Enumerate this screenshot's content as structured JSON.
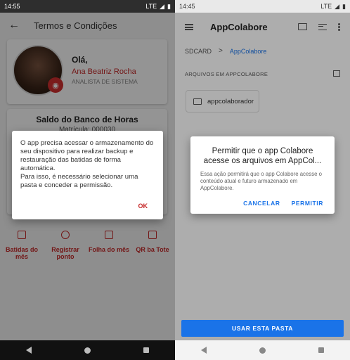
{
  "left": {
    "status_time": "14:55",
    "status_network": "LTE",
    "appbar_title": "Termos e Condições",
    "profile": {
      "greeting": "Olá,",
      "name": "Ana Beatriz Rocha",
      "role": "ANALISTA DE SISTEMA"
    },
    "bank": {
      "title": "Saldo do Banco de Horas",
      "subtitle": "Matrícula: 000030"
    },
    "shortcuts": [
      {
        "label": "Batidas do mês",
        "icon": "calendar-icon"
      },
      {
        "label": "Registrar ponto",
        "icon": "clock-icon"
      },
      {
        "label": "Folha do mês",
        "icon": "document-icon"
      },
      {
        "label": "QR ba Tote",
        "icon": "qr-code-icon"
      }
    ],
    "dialog": {
      "message_1": "O app precisa acessar o armazenamento do seu dispositivo para realizar backup e restauração das batidas de forma automática.",
      "message_2": "Para isso, é necessário selecionar uma pasta e conceder a permissão.",
      "ok_label": "OK"
    }
  },
  "right": {
    "status_time": "14:45",
    "status_network": "LTE",
    "appbar_title": "AppColabore",
    "breadcrumb": {
      "root": "SDCARD",
      "separator": ">",
      "current": "AppColabore"
    },
    "section_label": "ARQUIVOS EM APPCOLABORE",
    "folder_name": "appcolaborador",
    "use_button": "USAR ESTA PASTA",
    "dialog": {
      "title": "Permitir que o app Colabore acesse os arquivos em AppCol...",
      "message": "Essa ação permitirá que o app Colabore acesse o conteúdo atual e futuro armazenado em AppColabore.",
      "cancel_label": "CANCELAR",
      "allow_label": "PERMITIR"
    }
  },
  "colors": {
    "accent_red": "#c62828",
    "accent_blue": "#1a73e8"
  }
}
